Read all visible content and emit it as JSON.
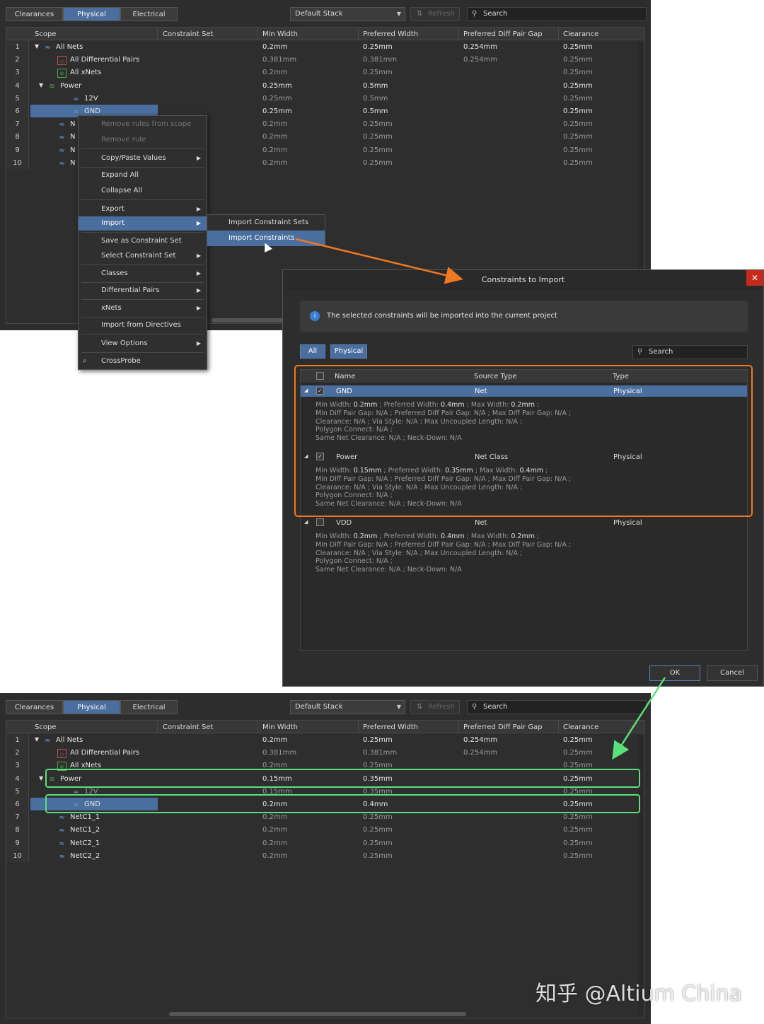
{
  "top_panel": {
    "tabs": [
      "Clearances",
      "Physical",
      "Electrical"
    ],
    "stack": "Default Stack",
    "refresh": "Refresh",
    "search": "Search",
    "columns": [
      "Scope",
      "Constraint Set",
      "Min Width",
      "Preferred Width",
      "Preferred Diff Pair Gap",
      "Clearance"
    ],
    "rows": [
      {
        "n": "1",
        "name": "All Nets",
        "min": "0.2mm",
        "pref": "0.25mm",
        "gap": "0.254mm",
        "clr": "0.25mm"
      },
      {
        "n": "2",
        "name": "All Differential Pairs",
        "min": "0.381mm",
        "pref": "0.381mm",
        "gap": "0.254mm",
        "clr": "0.25mm"
      },
      {
        "n": "3",
        "name": "All xNets",
        "min": "0.2mm",
        "pref": "0.25mm",
        "gap": "",
        "clr": "0.25mm"
      },
      {
        "n": "4",
        "name": "Power",
        "min": "0.25mm",
        "pref": "0.5mm",
        "gap": "",
        "clr": "0.25mm"
      },
      {
        "n": "5",
        "name": "12V",
        "min": "0.25mm",
        "pref": "0.5mm",
        "gap": "",
        "clr": "0.25mm"
      },
      {
        "n": "6",
        "name": "GND",
        "min": "0.25mm",
        "pref": "0.5mm",
        "gap": "",
        "clr": "0.25mm"
      },
      {
        "n": "7",
        "name": "N",
        "min": "0.2mm",
        "pref": "0.25mm",
        "gap": "",
        "clr": "0.25mm"
      },
      {
        "n": "8",
        "name": "N",
        "min": "0.2mm",
        "pref": "0.25mm",
        "gap": "",
        "clr": "0.25mm"
      },
      {
        "n": "9",
        "name": "N",
        "min": "0.2mm",
        "pref": "0.25mm",
        "gap": "",
        "clr": "0.25mm"
      },
      {
        "n": "10",
        "name": "N",
        "min": "0.2mm",
        "pref": "0.25mm",
        "gap": "",
        "clr": "0.25mm"
      }
    ]
  },
  "context_menu": {
    "remove_scope": "Remove rules from scope",
    "remove_rule": "Remove rule",
    "copy_paste": "Copy/Paste Values",
    "expand": "Expand All",
    "collapse": "Collapse All",
    "export": "Export",
    "import": "Import",
    "save_set": "Save as Constraint Set",
    "select_set": "Select Constraint Set",
    "classes": "Classes",
    "diff_pairs": "Differential Pairs",
    "xnets": "xNets",
    "import_directives": "Import from Directives",
    "view_options": "View Options",
    "crossprobe": "CrossProbe",
    "submenu": [
      "Import Constraint Sets",
      "Import Constraints"
    ]
  },
  "dialog": {
    "title": "Constraints to Import",
    "close": "✕",
    "info": "The selected constraints will be imported into the current project",
    "info_icon": "i",
    "btn_all": "All",
    "btn_physical": "Physical",
    "search": "Search",
    "columns": [
      "Name",
      "Source Type",
      "Type"
    ],
    "items": [
      {
        "name": "GND",
        "source": "Net",
        "type": "Physical",
        "d1": [
          "Min Width: ",
          "0.2mm",
          " ; Preferred Width: ",
          "0.4mm",
          " ; Max Width: ",
          "0.2mm",
          " ;"
        ],
        "d2": "Min Diff Pair Gap: N/A ; Preferred Diff Pair Gap: N/A ; Max Diff Pair Gap: N/A ;",
        "d3": "Clearance: N/A ; Via Style: N/A ; Max Uncoupled Length: N/A ;",
        "d4": "Polygon Connect: N/A ;",
        "d5": "Same Net Clearance: N/A ; Neck-Down: N/A"
      },
      {
        "name": "Power",
        "source": "Net Class",
        "type": "Physical",
        "d1": [
          "Min Width: ",
          "0.15mm",
          " ; Preferred Width: ",
          "0.35mm",
          " ; Max Width: ",
          "0.4mm",
          " ;"
        ],
        "d2": "Min Diff Pair Gap: N/A ; Preferred Diff Pair Gap: N/A ; Max Diff Pair Gap: N/A ;",
        "d3": "Clearance: N/A ; Via Style: N/A ; Max Uncoupled Length: N/A ;",
        "d4": "Polygon Connect: N/A ;",
        "d5": "Same Net Clearance: N/A ; Neck-Down: N/A"
      },
      {
        "name": "VDD",
        "source": "Net",
        "type": "Physical",
        "d1": [
          "Min Width: ",
          "0.2mm",
          " ; Preferred Width: ",
          "0.4mm",
          " ; Max Width: ",
          "0.2mm",
          " ;"
        ],
        "d2": "Min Diff Pair Gap: N/A ; Preferred Diff Pair Gap: N/A ; Max Diff Pair Gap: N/A ;",
        "d3": "Clearance: N/A ; Via Style: N/A ; Max Uncoupled Length: N/A ;",
        "d4": "Polygon Connect: N/A ;",
        "d5": "Same Net Clearance: N/A ; Neck-Down: N/A"
      }
    ],
    "ok": "OK",
    "cancel": "Cancel"
  },
  "bottom_panel": {
    "tabs": [
      "Clearances",
      "Physical",
      "Electrical"
    ],
    "stack": "Default Stack",
    "refresh": "Refresh",
    "search": "Search",
    "columns": [
      "Scope",
      "Constraint Set",
      "Min Width",
      "Preferred Width",
      "Preferred Diff Pair Gap",
      "Clearance"
    ],
    "rows": [
      {
        "n": "1",
        "name": "All Nets",
        "min": "0.2mm",
        "pref": "0.25mm",
        "gap": "0.254mm",
        "clr": "0.25mm"
      },
      {
        "n": "2",
        "name": "All Differential Pairs",
        "min": "0.381mm",
        "pref": "0.381mm",
        "gap": "0.254mm",
        "clr": "0.25mm"
      },
      {
        "n": "3",
        "name": "All xNets",
        "min": "0.2mm",
        "pref": "0.25mm",
        "gap": "",
        "clr": "0.25mm"
      },
      {
        "n": "4",
        "name": "Power",
        "min": "0.15mm",
        "pref": "0.35mm",
        "gap": "",
        "clr": "0.25mm"
      },
      {
        "n": "5",
        "name": "12V",
        "min": "0.15mm",
        "pref": "0.35mm",
        "gap": "",
        "clr": "0.25mm"
      },
      {
        "n": "6",
        "name": "GND",
        "min": "0.2mm",
        "pref": "0.4mm",
        "gap": "",
        "clr": "0.25mm"
      },
      {
        "n": "7",
        "name": "NetC1_1",
        "min": "0.2mm",
        "pref": "0.25mm",
        "gap": "",
        "clr": "0.25mm"
      },
      {
        "n": "8",
        "name": "NetC1_2",
        "min": "0.2mm",
        "pref": "0.25mm",
        "gap": "",
        "clr": "0.25mm"
      },
      {
        "n": "9",
        "name": "NetC2_1",
        "min": "0.2mm",
        "pref": "0.25mm",
        "gap": "",
        "clr": "0.25mm"
      },
      {
        "n": "10",
        "name": "NetC2_2",
        "min": "0.2mm",
        "pref": "0.25mm",
        "gap": "",
        "clr": "0.25mm"
      }
    ]
  },
  "watermark": "知乎 @Altium China",
  "colors": {
    "accent": "#4a6e9e",
    "orange_highlight": "#f07820",
    "green_highlight": "#5ae07a"
  }
}
